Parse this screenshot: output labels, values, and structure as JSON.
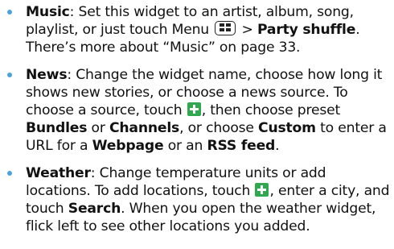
{
  "colors": {
    "bullet": "#4aa3df",
    "plus_green": "#2fa84f"
  },
  "icons": {
    "menu_key": "menu-key-icon",
    "add": "green-plus-icon"
  },
  "items": [
    {
      "term": "Music",
      "a": ": Set this widget to an artist, album, song, playlist, or just touch Menu ",
      "b": " > ",
      "c": "Party shuffle",
      "d": ". There’s more about “Music” on page 33."
    },
    {
      "term": "News",
      "a": ": Change the widget name, choose how long it shows new stories, or choose a news source. To choose a source, touch ",
      "b": ", then choose preset ",
      "c": "Bundles",
      "d": " or ",
      "e": "Channels",
      "f": ", or choose ",
      "g": "Custom",
      "h": " to enter a URL for a ",
      "i": "Webpage",
      "j": " or an ",
      "k": "RSS feed",
      "l": "."
    },
    {
      "term": "Weather",
      "a": ": Change temperature units or add locations. To add locations, touch ",
      "b": ", enter a city, and touch ",
      "c": "Search",
      "d": ". When you open the weather widget, flick left to see other locations you added."
    }
  ]
}
